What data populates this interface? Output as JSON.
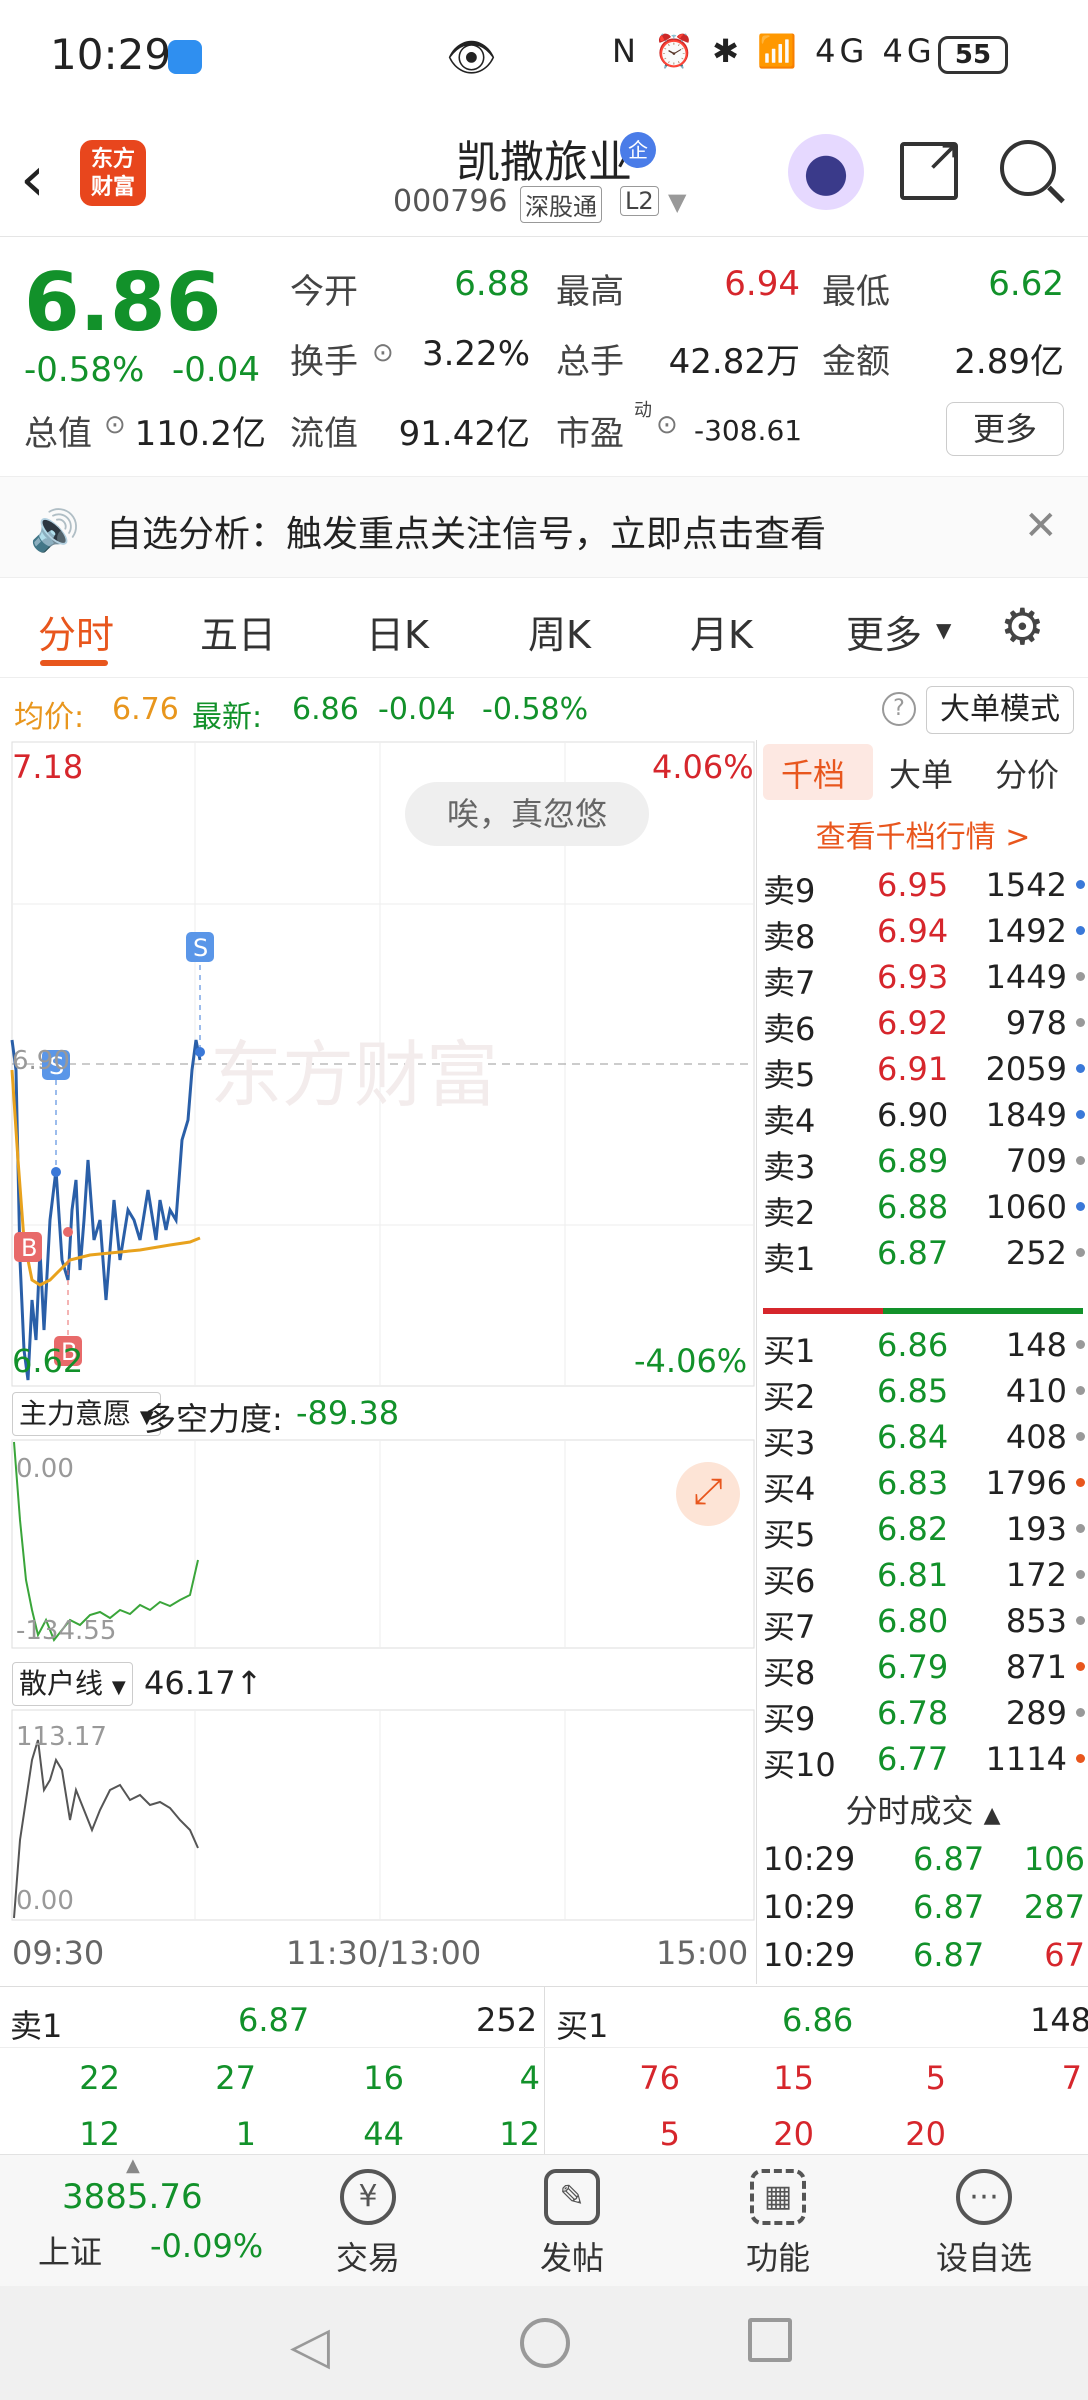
{
  "status_bar": {
    "time": "10:29",
    "battery": "55",
    "signal_icons": "N ⏰ ✱ 📶 4G 4G"
  },
  "header": {
    "logo_line1": "东方",
    "logo_line2": "财富",
    "stock_name": "凯撒旅业",
    "badge": "企",
    "code": "000796",
    "tag1": "深股通",
    "tag2": "L2"
  },
  "quote": {
    "price": "6.86",
    "change_pct": "-0.58%",
    "change": "-0.04",
    "fields": [
      {
        "label": "今开",
        "value": "6.88",
        "color": "green"
      },
      {
        "label": "最高",
        "value": "6.94",
        "color": "red"
      },
      {
        "label": "最低",
        "value": "6.62",
        "color": "green"
      },
      {
        "label": "换手",
        "value": "3.22%",
        "color": "dark"
      },
      {
        "label": "总手",
        "value": "42.82万",
        "color": "dark"
      },
      {
        "label": "金额",
        "value": "2.89亿",
        "color": "dark"
      },
      {
        "label": "总值",
        "value": "110.2亿",
        "color": "dark"
      },
      {
        "label": "流值",
        "value": "91.42亿",
        "color": "dark"
      },
      {
        "label": "市盈",
        "value": "-308.61",
        "color": "dark"
      }
    ],
    "pe_sup": "动",
    "more_label": "更多"
  },
  "notice": {
    "text": "自选分析：触发重点关注信号，立即点击查看"
  },
  "tabs": [
    "分时",
    "五日",
    "日K",
    "周K",
    "月K",
    "更多"
  ],
  "info_row": {
    "avg_label": "均价:",
    "avg_value": "6.76",
    "latest_label": "最新:",
    "latest_value": "6.86",
    "latest_change": "-0.04",
    "latest_pct": "-0.58%",
    "mode_label": "大单模式"
  },
  "chart": {
    "y_top": "7.18",
    "y_bottom": "6.62",
    "pct_top": "4.06%",
    "pct_bottom": "-4.06%",
    "ref_label": "6.90",
    "watermark": "东方财富",
    "toast": "唉，真忽悠",
    "marker_s": "S",
    "marker_b": "B",
    "ind1_select": "主力意愿",
    "ind1_label": "多空力度:",
    "ind1_value": "-89.38",
    "ind1_top": "0.00",
    "ind1_bottom": "-134.55",
    "ind2_select": "散户线",
    "ind2_value": "46.17↑",
    "ind2_top": "113.17",
    "ind2_bottom": "0.00",
    "time_start": "09:30",
    "time_mid": "11:30/13:00",
    "time_end": "15:00"
  },
  "book": {
    "tabs": [
      "千档",
      "大单",
      "分价"
    ],
    "link": "查看千档行情 >",
    "asks": [
      {
        "label": "卖9",
        "price": "6.95",
        "vol": "1542",
        "dot": "#3a78d8"
      },
      {
        "label": "卖8",
        "price": "6.94",
        "vol": "1492",
        "dot": "#3a78d8"
      },
      {
        "label": "卖7",
        "price": "6.93",
        "vol": "1449",
        "dot": "#999999"
      },
      {
        "label": "卖6",
        "price": "6.92",
        "vol": "978",
        "dot": "#999999"
      },
      {
        "label": "卖5",
        "price": "6.91",
        "vol": "2059",
        "dot": "#3a78d8"
      },
      {
        "label": "卖4",
        "price": "6.90",
        "vol": "1849",
        "dot": "#3a78d8"
      },
      {
        "label": "卖3",
        "price": "6.89",
        "vol": "709",
        "dot": "#999999"
      },
      {
        "label": "卖2",
        "price": "6.88",
        "vol": "1060",
        "dot": "#3a78d8"
      },
      {
        "label": "卖1",
        "price": "6.87",
        "vol": "252",
        "dot": "#999999"
      }
    ],
    "bids": [
      {
        "label": "买1",
        "price": "6.86",
        "vol": "148",
        "dot": "#999999"
      },
      {
        "label": "买2",
        "price": "6.85",
        "vol": "410",
        "dot": "#999999"
      },
      {
        "label": "买3",
        "price": "6.84",
        "vol": "408",
        "dot": "#999999"
      },
      {
        "label": "买4",
        "price": "6.83",
        "vol": "1796",
        "dot": "#e8561d"
      },
      {
        "label": "买5",
        "price": "6.82",
        "vol": "193",
        "dot": "#999999"
      },
      {
        "label": "买6",
        "price": "6.81",
        "vol": "172",
        "dot": "#999999"
      },
      {
        "label": "买7",
        "price": "6.80",
        "vol": "853",
        "dot": "#999999"
      },
      {
        "label": "买8",
        "price": "6.79",
        "vol": "871",
        "dot": "#e8561d"
      },
      {
        "label": "买9",
        "price": "6.78",
        "vol": "289",
        "dot": "#999999"
      },
      {
        "label": "买10",
        "price": "6.77",
        "vol": "1114",
        "dot": "#e8561d"
      }
    ],
    "trades_title": "分时成交",
    "trades": [
      {
        "time": "10:29",
        "price": "6.87",
        "vol": "106"
      },
      {
        "time": "10:29",
        "price": "6.87",
        "vol": "287"
      },
      {
        "time": "10:29",
        "price": "6.87",
        "vol": "67"
      }
    ]
  },
  "bottom_panel": {
    "sell_label": "卖1",
    "sell_price": "6.87",
    "sell_vol": "252",
    "buy_label": "买1",
    "buy_price": "6.86",
    "buy_vol": "148",
    "sell_rows": [
      [
        "22",
        "27",
        "16",
        "4"
      ],
      [
        "12",
        "1",
        "44",
        "12"
      ]
    ],
    "buy_rows": [
      [
        "76",
        "15",
        "5",
        "7"
      ],
      [
        "5",
        "20",
        "20",
        ""
      ]
    ]
  },
  "nav": {
    "index_value": "3885.76",
    "index_name": "上证",
    "index_change": "-0.09%",
    "items": [
      "交易",
      "发帖",
      "功能",
      "设自选"
    ]
  }
}
